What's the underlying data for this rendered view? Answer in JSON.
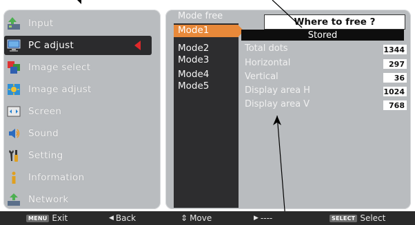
{
  "menu": {
    "items": [
      {
        "label": "Input",
        "icon": "input-icon"
      },
      {
        "label": "PC adjust",
        "icon": "pc-adjust-icon",
        "selected": true
      },
      {
        "label": "Image select",
        "icon": "image-select-icon"
      },
      {
        "label": "Image adjust",
        "icon": "image-adjust-icon"
      },
      {
        "label": "Screen",
        "icon": "screen-icon"
      },
      {
        "label": "Sound",
        "icon": "sound-icon"
      },
      {
        "label": "Setting",
        "icon": "setting-icon"
      },
      {
        "label": "Information",
        "icon": "information-icon"
      },
      {
        "label": "Network",
        "icon": "network-icon"
      }
    ]
  },
  "modes": {
    "header": "Mode free",
    "items": [
      "Mode1",
      "Mode2",
      "Mode3",
      "Mode4",
      "Mode5"
    ],
    "selected_index": 0
  },
  "dialog": {
    "prompt": "Where to free ?",
    "status": "Stored"
  },
  "info": {
    "rows": [
      {
        "label": "Total dots",
        "value": "1344"
      },
      {
        "label": "Horizontal",
        "value": "297"
      },
      {
        "label": "Vertical",
        "value": "36"
      },
      {
        "label": "Display area H",
        "value": "1024"
      },
      {
        "label": "Display area V",
        "value": "768"
      }
    ]
  },
  "bottom_bar": {
    "exit": {
      "key": "MENU",
      "label": "Exit"
    },
    "back": {
      "glyph": "◀",
      "label": "Back"
    },
    "move": {
      "glyph": "⇕",
      "label": "Move"
    },
    "next": {
      "glyph": "▶",
      "label": "----"
    },
    "select": {
      "key": "SELECT",
      "label": "Select"
    }
  },
  "colors": {
    "panel": "#b9bcbf",
    "selected_menu": "#2b2b2d",
    "mode_column": "#2d2d2f",
    "mode_highlight": "#e8893a",
    "arrow_red": "#e0282a"
  }
}
